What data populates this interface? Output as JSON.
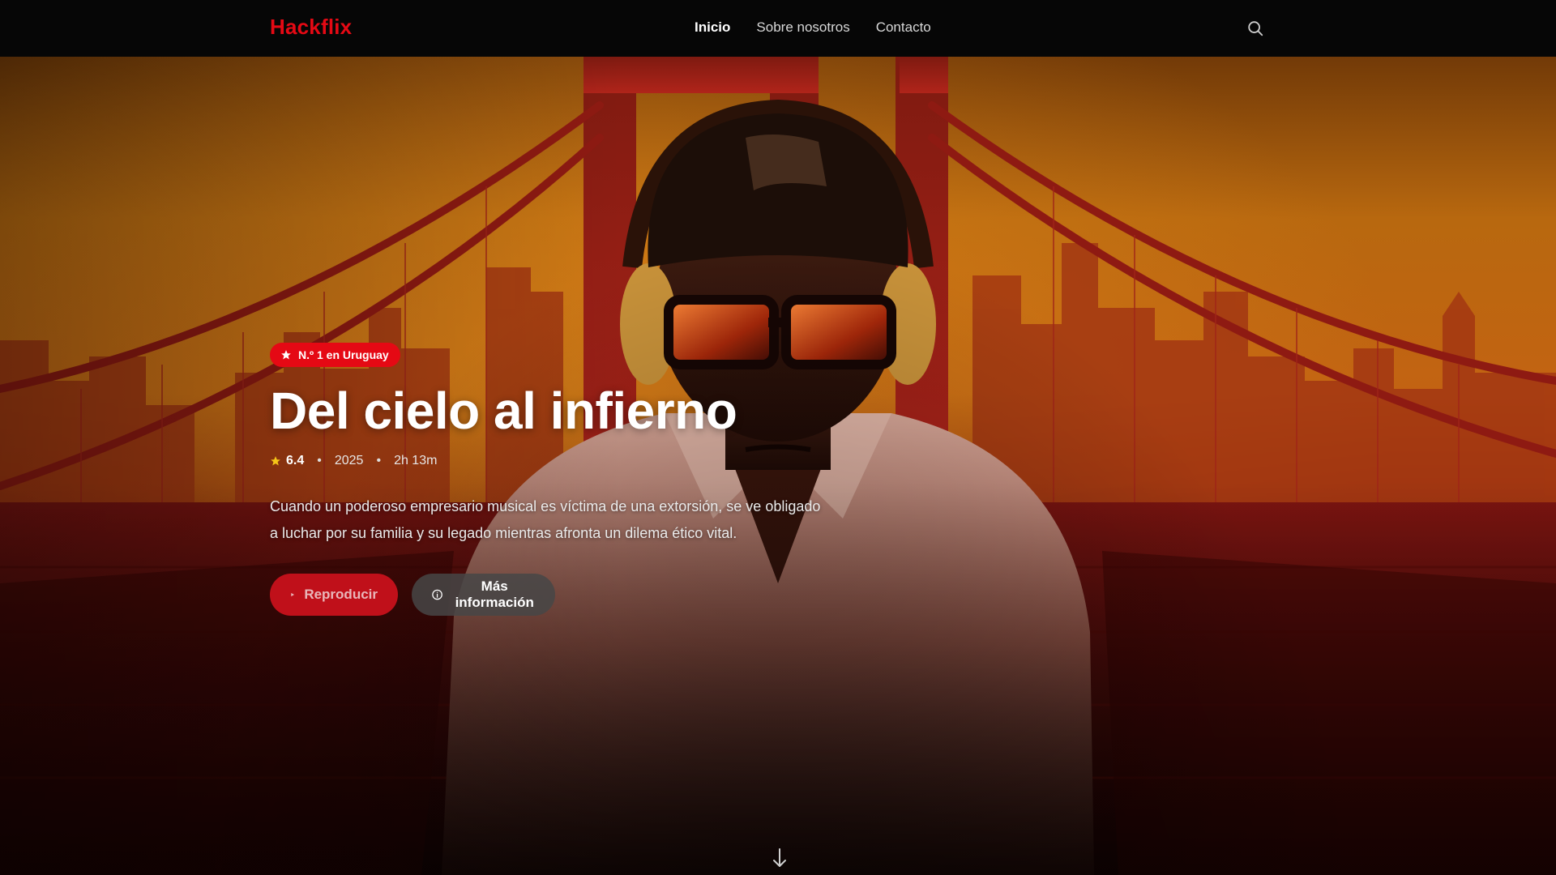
{
  "navbar": {
    "logo": "Hackflix",
    "links": [
      {
        "label": "Inicio",
        "active": true
      },
      {
        "label": "Sobre nosotros",
        "active": false
      },
      {
        "label": "Contacto",
        "active": false
      }
    ],
    "search_icon": "search-icon"
  },
  "hero": {
    "badge": "N.º 1 en Uruguay",
    "title": "Del cielo al infierno",
    "rating": "6.4",
    "year": "2025",
    "duration": "2h 13m",
    "description": "Cuando un poderoso empresario musical es víctima de una extorsión, se ve obligado a luchar por su familia y su legado mientras afronta un dilema ético vital.",
    "play_label": "Reproducir",
    "info_label": "Más información",
    "scroll_icon": "arrow-down-icon"
  },
  "colors": {
    "brand": "#e50914",
    "navbar_bg": "#060606",
    "star": "#f5c518"
  }
}
